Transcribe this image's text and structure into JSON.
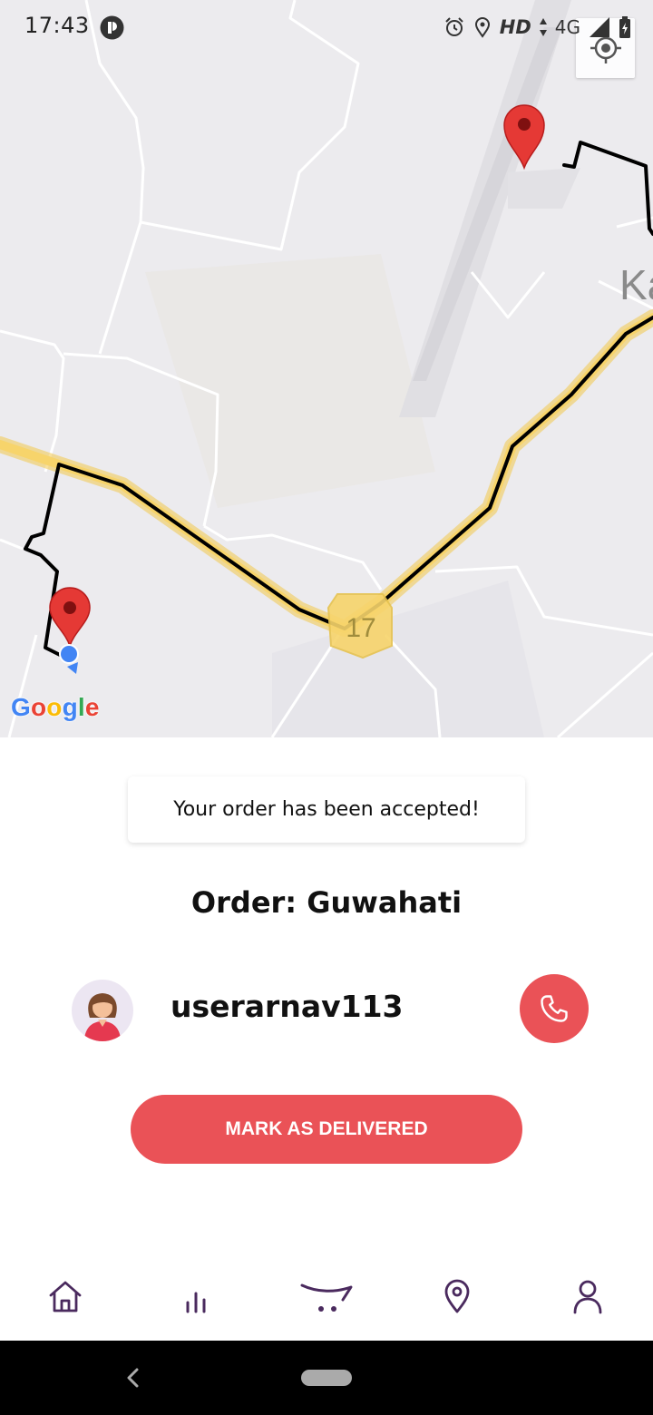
{
  "status_bar": {
    "time": "17:43",
    "hd": "HD",
    "network": "4G",
    "icons": [
      "alarm-icon",
      "location-icon",
      "signal-icon",
      "battery-icon"
    ]
  },
  "map": {
    "road_label": "17",
    "place_label": "Ka",
    "attribution": "Google",
    "route_colors": {
      "route": "#000000",
      "highway": "#f7d46b",
      "marker": "#e53935",
      "current_location": "#4285f4"
    }
  },
  "toast": {
    "message": "Your order has been accepted!"
  },
  "order": {
    "title": "Order: Guwahati"
  },
  "customer": {
    "username": "userarnav113"
  },
  "actions": {
    "deliver_label": "MARK AS DELIVERED"
  },
  "bottom_nav": {
    "items": [
      "home-icon",
      "stats-icon",
      "cart-icon",
      "location-pin-icon",
      "profile-icon"
    ],
    "accent": "#4a2a5e"
  },
  "colors": {
    "accent": "#ea5257"
  }
}
